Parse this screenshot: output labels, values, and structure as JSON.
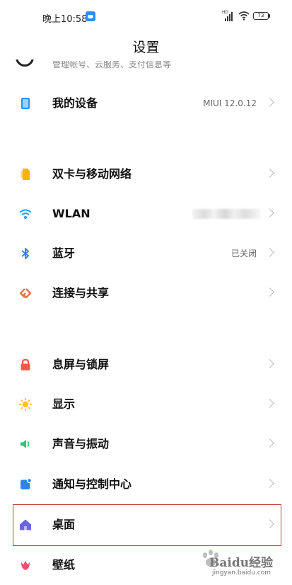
{
  "status_bar": {
    "time": "晚上10:58",
    "network": "HD",
    "battery": "73"
  },
  "page": {
    "title": "设置"
  },
  "account": {
    "subtitle": "管理帐号、云服务、支付信息等"
  },
  "rows": {
    "device": {
      "label": "我的设备",
      "value": "MIUI 12.0.12"
    },
    "sim": {
      "label": "双卡与移动网络"
    },
    "wlan": {
      "label": "WLAN"
    },
    "bluetooth": {
      "label": "蓝牙",
      "value": "已关闭"
    },
    "connection": {
      "label": "连接与共享"
    },
    "lock": {
      "label": "息屏与锁屏"
    },
    "display": {
      "label": "显示"
    },
    "sound": {
      "label": "声音与振动"
    },
    "notification": {
      "label": "通知与控制中心"
    },
    "home": {
      "label": "桌面"
    },
    "wallpaper": {
      "label": "壁纸"
    }
  },
  "watermark": {
    "brand": "Baidu经验",
    "url": "jingyan.baidu.com"
  },
  "colors": {
    "device_icon": "#2b8ff5",
    "sim_icon": "#f5b400",
    "wifi_icon": "#1aa0ef",
    "bluetooth_icon": "#2a88f0",
    "connection_icon": "#f07045",
    "lock_icon": "#f05a4e",
    "display_icon": "#f8c31a",
    "sound_icon": "#35c270",
    "notification_icon": "#2d84f0",
    "home_icon": "#6c63e8",
    "wallpaper_icon": "#f04e70",
    "highlight": "#c93a3a"
  }
}
